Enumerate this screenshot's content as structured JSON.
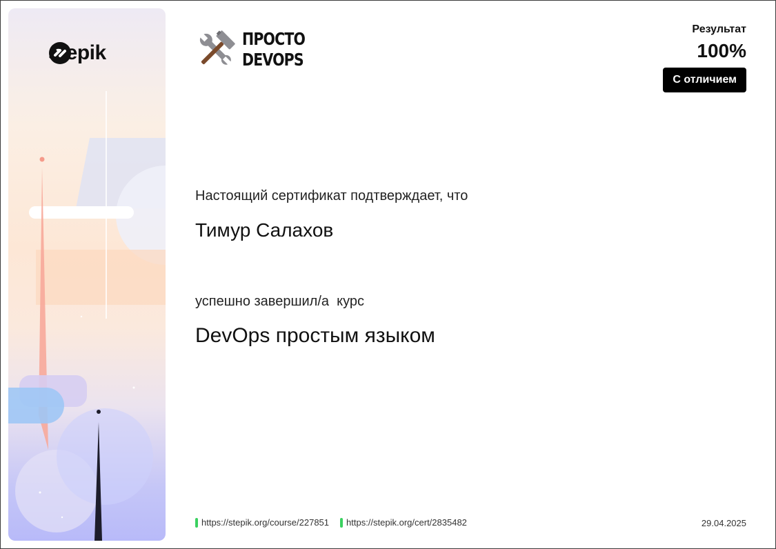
{
  "brand": {
    "name": "stepik"
  },
  "course_logo": {
    "line1": "ПРОСТО",
    "line2": "DEVOPS",
    "icon": "crossed-hammer-wrench-icon"
  },
  "result": {
    "label": "Результат",
    "value": "100%",
    "badge": "С отличием"
  },
  "certificate": {
    "statement": "Настоящий сертификат подтверждает, что",
    "recipient": "Тимур Салахов",
    "completed_text": "успешно завершил/а  курс",
    "course_name": "DevOps простым языком"
  },
  "footer": {
    "course_link": "https://stepik.org/course/227851",
    "cert_link": "https://stepik.org/cert/2835482",
    "date": "29.04.2025"
  },
  "colors": {
    "accent_green": "#3bd160",
    "badge_bg": "#000000"
  }
}
